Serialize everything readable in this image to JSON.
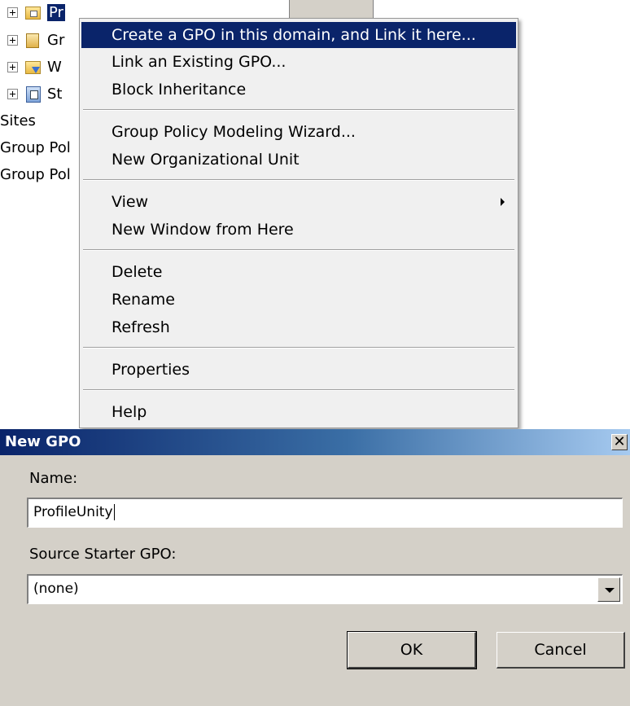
{
  "tree": {
    "items": [
      {
        "label": "Pr",
        "icon": "ou-icon",
        "selected": true
      },
      {
        "label": "Gr",
        "icon": "gpo-icon"
      },
      {
        "label": "W",
        "icon": "wmi-filter-icon"
      },
      {
        "label": "St",
        "icon": "starter-gpo-icon"
      }
    ],
    "sites_label": "Sites",
    "gp_modeling_label": "Group Pol",
    "gp_results_label": "Group Pol"
  },
  "context_menu": {
    "items": [
      {
        "label": "Create a GPO in this domain, and Link it here...",
        "highlighted": true
      },
      {
        "label": "Link an Existing GPO..."
      },
      {
        "label": "Block Inheritance"
      },
      {
        "label": "Group Policy Modeling Wizard..."
      },
      {
        "label": "New Organizational Unit"
      },
      {
        "label": "View",
        "submenu": true
      },
      {
        "label": "New Window from Here"
      },
      {
        "label": "Delete"
      },
      {
        "label": "Rename"
      },
      {
        "label": "Refresh"
      },
      {
        "label": "Properties"
      },
      {
        "label": "Help"
      }
    ]
  },
  "dialog": {
    "title": "New GPO",
    "close_glyph": "✕",
    "name_label": "Name:",
    "name_value": "ProfileUnity",
    "source_label": "Source Starter GPO:",
    "source_value": "(none)",
    "ok_label": "OK",
    "cancel_label": "Cancel"
  }
}
